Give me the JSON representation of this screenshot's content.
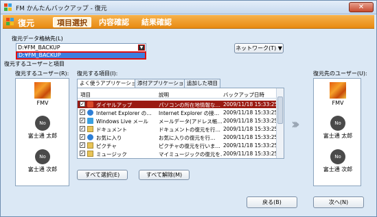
{
  "window": {
    "title": "FM かんたんバックアップ - 復元",
    "close": "✕"
  },
  "header": {
    "title": "復元",
    "steps": [
      "項目選択",
      "内容確認",
      "結果確認"
    ]
  },
  "storage": {
    "label": "復元データ格納先(L)",
    "value": "D:¥FM_BACKUP",
    "dropdown_option": "D:¥FM_BACKUP"
  },
  "network_button": "ネットワーク(T) ▼",
  "section_label": "復元するユーザーと項目",
  "source_users": {
    "label": "復元するユーザー(R):",
    "items": [
      {
        "name": "FMV",
        "avatar": "autumn"
      },
      {
        "name": "富士通 太郎",
        "avatar": "No"
      },
      {
        "name": "富士通 次郎",
        "avatar": "No"
      }
    ]
  },
  "items": {
    "label": "復元する項目(I):",
    "tabs": [
      "よく使うアプリケーション",
      "添付アプリケーション",
      "追加した項目"
    ],
    "columns": [
      "項目",
      "説明",
      "バックアップ日時"
    ],
    "rows": [
      {
        "name": "ダイヤルアップ",
        "desc": "パソコンの所在地情報な…",
        "date": "2009/11/18 15:33:25",
        "icon": "dialup-icon",
        "selected": true
      },
      {
        "name": "Internet Explorer の…",
        "desc": "Internet Explorer の接…",
        "date": "2009/11/18 15:33:25",
        "icon": "ie-icon"
      },
      {
        "name": "Windows Live メール",
        "desc": "メールデータ(アドレス帳…",
        "date": "2009/11/18 15:33:25",
        "icon": "mail-icon"
      },
      {
        "name": "ドキュメント",
        "desc": "ドキュメントの復元を行…",
        "date": "2009/11/18 15:33:25",
        "icon": "folder-icon"
      },
      {
        "name": "お気に入り",
        "desc": "お気に入りの復元を行…",
        "date": "2009/11/18 15:33:25",
        "icon": "ie-icon"
      },
      {
        "name": "ピクチャ",
        "desc": "ピクチャの復元を行いま…",
        "date": "2009/11/18 15:33:25",
        "icon": "folder-icon"
      },
      {
        "name": "ミュージック",
        "desc": "マイミュージックの復元を…",
        "date": "2009/11/18 15:33:25",
        "icon": "folder-icon"
      }
    ],
    "select_all": "すべて選択(E)",
    "deselect_all": "すべて解除(M)"
  },
  "dest_users": {
    "label": "復元先のユーザー(U):",
    "items": [
      {
        "name": "FMV",
        "avatar": "autumn"
      },
      {
        "name": "富士通 太郎",
        "avatar": "No"
      },
      {
        "name": "富士通 次郎",
        "avatar": "No"
      }
    ]
  },
  "footer": {
    "back": "戻る(B)",
    "next": "次へ(N)"
  },
  "colors": {
    "header": "#f09a22",
    "selected_row": "#9a1a12",
    "dropdown_highlight": "#3d7fe0"
  }
}
